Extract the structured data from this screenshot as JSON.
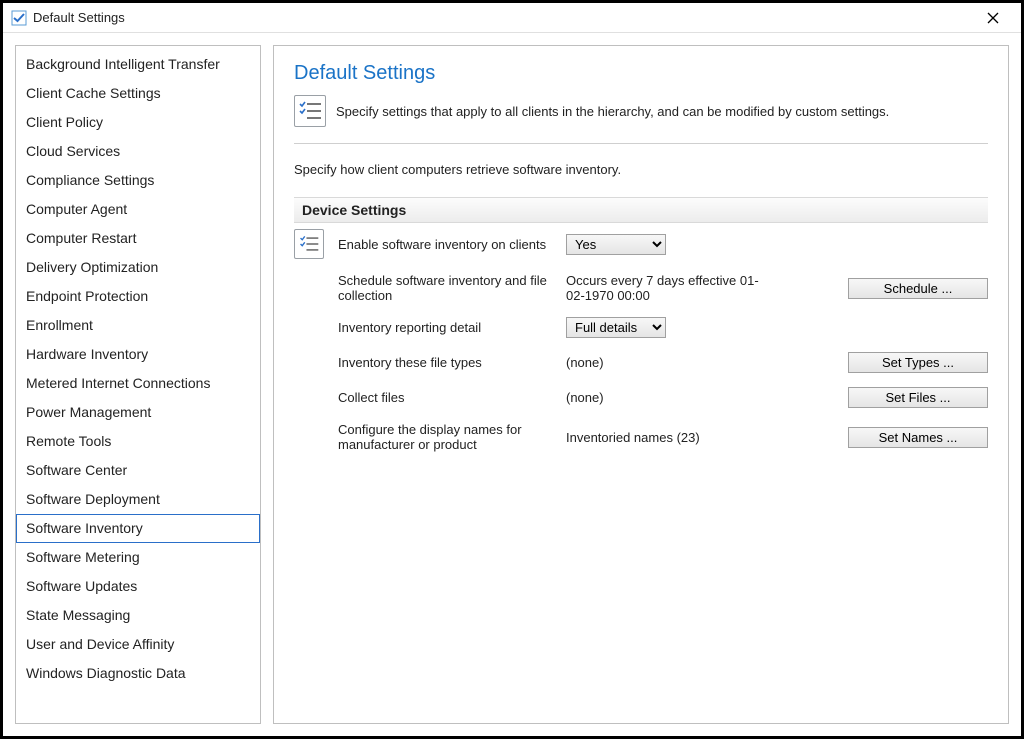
{
  "window": {
    "title": "Default Settings"
  },
  "sidebar": {
    "items": [
      "Background Intelligent Transfer",
      "Client Cache Settings",
      "Client Policy",
      "Cloud Services",
      "Compliance Settings",
      "Computer Agent",
      "Computer Restart",
      "Delivery Optimization",
      "Endpoint Protection",
      "Enrollment",
      "Hardware Inventory",
      "Metered Internet Connections",
      "Power Management",
      "Remote Tools",
      "Software Center",
      "Software Deployment",
      "Software Inventory",
      "Software Metering",
      "Software Updates",
      "State Messaging",
      "User and Device Affinity",
      "Windows Diagnostic Data"
    ],
    "selected_index": 16
  },
  "main": {
    "title": "Default Settings",
    "intro": "Specify settings that apply to all clients in the hierarchy, and can be modified by custom settings.",
    "section_intro": "Specify how client computers retrieve software inventory.",
    "section_header": "Device Settings",
    "rows": {
      "enable": {
        "label": "Enable software inventory on clients",
        "value": "Yes"
      },
      "schedule": {
        "label": "Schedule software inventory and file collection",
        "value": "Occurs every 7 days effective 01-02-1970 00:00",
        "button": "Schedule ..."
      },
      "detail": {
        "label": "Inventory reporting detail",
        "value": "Full details"
      },
      "types": {
        "label": "Inventory these file types",
        "value": "(none)",
        "button": "Set Types ..."
      },
      "collect": {
        "label": "Collect files",
        "value": "(none)",
        "button": "Set Files ..."
      },
      "names": {
        "label": "Configure the display names for manufacturer or product",
        "value": "Inventoried names (23)",
        "button": "Set Names ..."
      }
    }
  }
}
